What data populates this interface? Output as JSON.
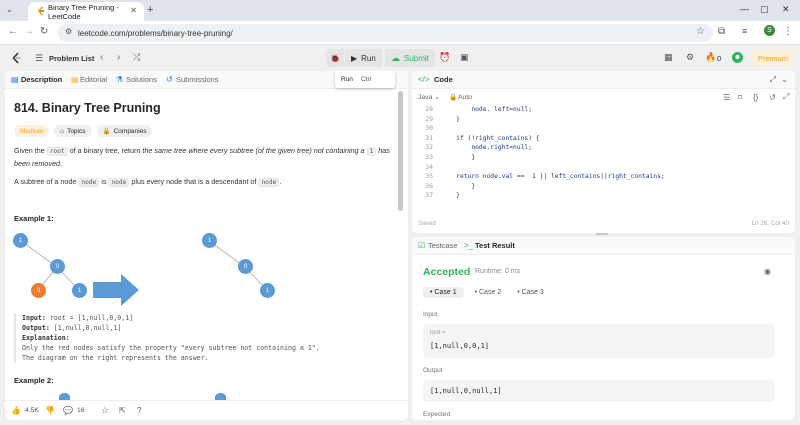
{
  "browser": {
    "tab_title": "Binary Tree Pruning - LeetCode",
    "url": "leetcode.com/problems/binary-tree-pruning/",
    "profile_initial": "S"
  },
  "topbar": {
    "problem_list": "Problem List",
    "run": "Run",
    "submit": "Submit",
    "streak": "0",
    "premium": "Premium"
  },
  "left": {
    "tabs": [
      "Description",
      "Editorial",
      "Solutions",
      "Submissions"
    ],
    "tooltip": {
      "label": "Run",
      "key": "Ctrl"
    },
    "title": "814. Binary Tree Pruning",
    "difficulty": "Medium",
    "tags": [
      "Topics",
      "Companies"
    ],
    "desc": {
      "p1_a": "Given the",
      "p1_code1": "root",
      "p1_b": "of a binary tree, return",
      "p1_em": "the same tree where every subtree (of the given tree) not containing a",
      "p1_code2": "1",
      "p1_em2": "has been removed",
      "p1_end": ".",
      "p2_a": "A subtree of a node",
      "p2_code1": "node",
      "p2_b": "is",
      "p2_code2": "node",
      "p2_c": "plus every node that is a descendant of",
      "p2_code3": "node",
      "p2_end": "."
    },
    "example1": {
      "heading": "Example 1:",
      "left_tree": [
        "1",
        "0",
        "0",
        "1"
      ],
      "right_tree": [
        "1",
        "0",
        "1"
      ],
      "input_label": "Input:",
      "input": "root = [1,null,0,0,1]",
      "output_label": "Output:",
      "output": "[1,null,0,null,1]",
      "expl_label": "Explanation:",
      "expl_1": "Only the red nodes satisfy the property \"every subtree not containing a 1\".",
      "expl_2": "The diagram on the right represents the answer."
    },
    "example2_heading": "Example 2:",
    "footer": {
      "likes": "4.5K",
      "comments": "16"
    }
  },
  "code": {
    "tab": "Code",
    "language": "Java",
    "mode": "Auto",
    "lines": [
      {
        "n": "28",
        "t": "        node. left=null;"
      },
      {
        "n": "29",
        "t": "    }"
      },
      {
        "n": "30",
        "t": ""
      },
      {
        "n": "31",
        "t": "    if (!right_contains) {"
      },
      {
        "n": "32",
        "t": "        node.right=null;"
      },
      {
        "n": "33",
        "t": "        }"
      },
      {
        "n": "34",
        "t": ""
      },
      {
        "n": "35",
        "t": "    return node.val ==  1 || left_contains||right_contains;"
      },
      {
        "n": "36",
        "t": "        }"
      },
      {
        "n": "37",
        "t": "    }"
      }
    ],
    "saved": "Saved",
    "position": "Ln 26, Col 40"
  },
  "result": {
    "tabs": [
      "Testcase",
      "Test Result"
    ],
    "status": "Accepted",
    "runtime": "Runtime: 0 ms",
    "cases": [
      "Case 1",
      "Case 2",
      "Case 3"
    ],
    "input_label": "Input",
    "input_var": "root =",
    "input_value": "[1,null,0,0,1]",
    "output_label": "Output",
    "output_value": "[1,null,0,null,1]",
    "expected_label": "Expected"
  },
  "colors": {
    "accepted": "#2db55d",
    "accent": "#ffa116",
    "node_blue": "#5b9bd5",
    "node_orange": "#ed7d31"
  }
}
